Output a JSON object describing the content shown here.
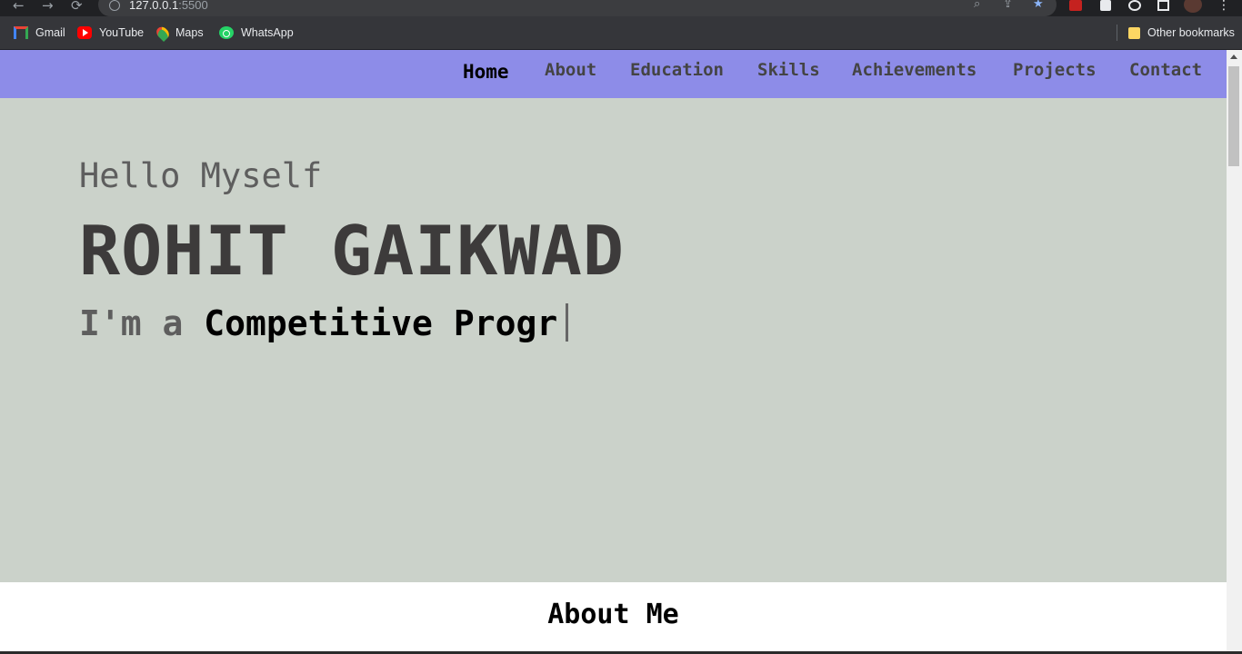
{
  "browser": {
    "url_host": "127.0.0.1",
    "url_port": ":5500",
    "bookmarks": [
      {
        "label": "Gmail",
        "icon": "gmail-icon"
      },
      {
        "label": "YouTube",
        "icon": "youtube-icon"
      },
      {
        "label": "Maps",
        "icon": "maps-icon"
      },
      {
        "label": "WhatsApp",
        "icon": "whatsapp-icon"
      }
    ],
    "other_bookmarks": "Other bookmarks"
  },
  "site": {
    "nav": {
      "items": [
        {
          "label": "Home",
          "active": true
        },
        {
          "label": "About"
        },
        {
          "label": "Education"
        },
        {
          "label": "Skills"
        },
        {
          "label": "Achievements"
        },
        {
          "label": "Projects"
        },
        {
          "label": "Contact"
        }
      ]
    },
    "hero": {
      "greeting": "Hello Myself",
      "name": "ROHIT GAIKWAD",
      "typing_prefix": "I'm a ",
      "typing_text": "Competitive Progr"
    },
    "about": {
      "title": "About Me"
    }
  },
  "colors": {
    "nav_bg": "#8d8ce8",
    "hero_bg": "#cbd2ca"
  }
}
